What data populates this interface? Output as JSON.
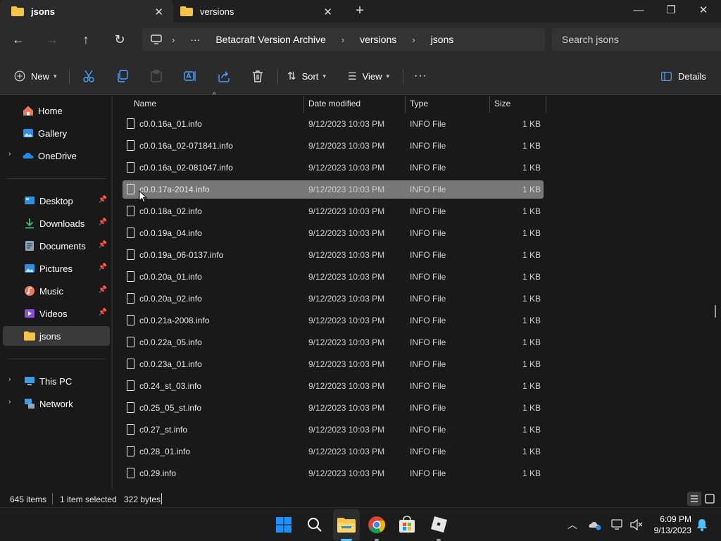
{
  "tabs": [
    {
      "label": "jsons",
      "active": true
    },
    {
      "label": "versions",
      "active": false
    }
  ],
  "window_controls": {
    "minimize": "—",
    "maximize": "❐",
    "close": "✕"
  },
  "new_tab_label": "+",
  "address": {
    "segments": [
      "Betacraft Version Archive",
      "versions",
      "jsons"
    ],
    "overflow": "···"
  },
  "search": {
    "placeholder": "Search jsons"
  },
  "toolbar": {
    "new_label": "New",
    "sort_label": "Sort",
    "view_label": "View",
    "more_label": "···",
    "details_label": "Details"
  },
  "sidebar": {
    "quick": [
      {
        "label": "Home",
        "icon": "home-icon"
      },
      {
        "label": "Gallery",
        "icon": "gallery-icon"
      },
      {
        "label": "OneDrive",
        "icon": "cloud-icon"
      }
    ],
    "pinned": [
      {
        "label": "Desktop",
        "icon": "desktop-icon"
      },
      {
        "label": "Downloads",
        "icon": "download-icon"
      },
      {
        "label": "Documents",
        "icon": "documents-icon"
      },
      {
        "label": "Pictures",
        "icon": "pictures-icon"
      },
      {
        "label": "Music",
        "icon": "music-icon"
      },
      {
        "label": "Videos",
        "icon": "videos-icon"
      },
      {
        "label": "jsons",
        "icon": "folder-icon"
      }
    ],
    "system": [
      {
        "label": "This PC",
        "icon": "pc-icon"
      },
      {
        "label": "Network",
        "icon": "network-icon"
      }
    ]
  },
  "columns": {
    "name": "Name",
    "date": "Date modified",
    "type": "Type",
    "size": "Size"
  },
  "files": [
    {
      "name": "c0.0.16a_01.info",
      "date": "9/12/2023 10:03 PM",
      "type": "INFO File",
      "size": "1 KB"
    },
    {
      "name": "c0.0.16a_02-071841.info",
      "date": "9/12/2023 10:03 PM",
      "type": "INFO File",
      "size": "1 KB"
    },
    {
      "name": "c0.0.16a_02-081047.info",
      "date": "9/12/2023 10:03 PM",
      "type": "INFO File",
      "size": "1 KB"
    },
    {
      "name": "c0.0.17a-2014.info",
      "date": "9/12/2023 10:03 PM",
      "type": "INFO File",
      "size": "1 KB",
      "selected": true
    },
    {
      "name": "c0.0.18a_02.info",
      "date": "9/12/2023 10:03 PM",
      "type": "INFO File",
      "size": "1 KB"
    },
    {
      "name": "c0.0.19a_04.info",
      "date": "9/12/2023 10:03 PM",
      "type": "INFO File",
      "size": "1 KB"
    },
    {
      "name": "c0.0.19a_06-0137.info",
      "date": "9/12/2023 10:03 PM",
      "type": "INFO File",
      "size": "1 KB"
    },
    {
      "name": "c0.0.20a_01.info",
      "date": "9/12/2023 10:03 PM",
      "type": "INFO File",
      "size": "1 KB"
    },
    {
      "name": "c0.0.20a_02.info",
      "date": "9/12/2023 10:03 PM",
      "type": "INFO File",
      "size": "1 KB"
    },
    {
      "name": "c0.0.21a-2008.info",
      "date": "9/12/2023 10:03 PM",
      "type": "INFO File",
      "size": "1 KB"
    },
    {
      "name": "c0.0.22a_05.info",
      "date": "9/12/2023 10:03 PM",
      "type": "INFO File",
      "size": "1 KB"
    },
    {
      "name": "c0.0.23a_01.info",
      "date": "9/12/2023 10:03 PM",
      "type": "INFO File",
      "size": "1 KB"
    },
    {
      "name": "c0.24_st_03.info",
      "date": "9/12/2023 10:03 PM",
      "type": "INFO File",
      "size": "1 KB"
    },
    {
      "name": "c0.25_05_st.info",
      "date": "9/12/2023 10:03 PM",
      "type": "INFO File",
      "size": "1 KB"
    },
    {
      "name": "c0.27_st.info",
      "date": "9/12/2023 10:03 PM",
      "type": "INFO File",
      "size": "1 KB"
    },
    {
      "name": "c0.28_01.info",
      "date": "9/12/2023 10:03 PM",
      "type": "INFO File",
      "size": "1 KB"
    },
    {
      "name": "c0.29.info",
      "date": "9/12/2023 10:03 PM",
      "type": "INFO File",
      "size": "1 KB"
    }
  ],
  "status": {
    "item_count": "645 items",
    "selection": "1 item selected",
    "selection_size": "322 bytes"
  },
  "clock": {
    "time": "6:09 PM",
    "date": "9/13/2023"
  },
  "colors": {
    "accent": "#0078d4",
    "folder": "#f6c34a",
    "selection": "#777777"
  }
}
